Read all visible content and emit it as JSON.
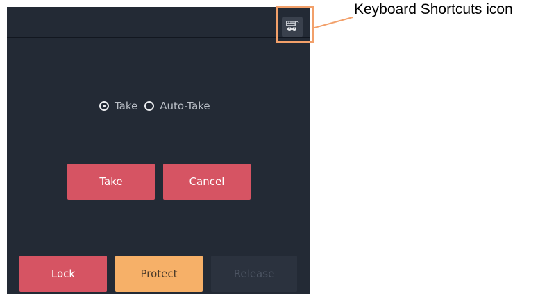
{
  "callout": {
    "label": "Keyboard Shortcuts icon",
    "color": "#f2a06a"
  },
  "toolbar": {
    "keyboard_icon": "keyboard-shortcuts-icon"
  },
  "take_mode": {
    "options": [
      {
        "label": "Take",
        "selected": true
      },
      {
        "label": "Auto-Take",
        "selected": false
      }
    ]
  },
  "actions": {
    "take_label": "Take",
    "cancel_label": "Cancel"
  },
  "bottom_actions": {
    "lock_label": "Lock",
    "protect_label": "Protect",
    "release_label": "Release",
    "release_enabled": false
  },
  "colors": {
    "panel_bg": "#232a35",
    "accent_red": "#d65463",
    "accent_orange": "#f6b068"
  }
}
